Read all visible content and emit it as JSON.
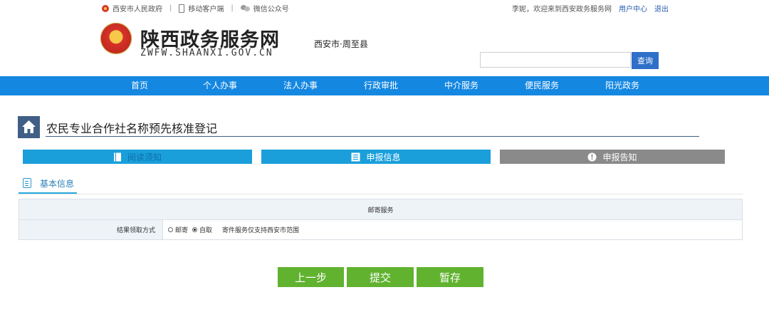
{
  "topbar": {
    "gov_link": "西安市人民政府",
    "mobile_link": "移动客户端",
    "wechat_link": "微信公众号",
    "welcome": "李妮，欢迎来到西安政务服务网",
    "user_center": "用户中心",
    "logout": "退出"
  },
  "header": {
    "site_title": "陕西政务服务网",
    "site_subtitle": "ZWFW.SHAANXI.GOV.CN",
    "region": "西安市·周至县",
    "search_placeholder": "",
    "search_button": "查询"
  },
  "nav": [
    "首页",
    "个人办事",
    "法人办事",
    "行政审批",
    "中介服务",
    "便民服务",
    "阳光政务"
  ],
  "page": {
    "title": "农民专业合作社名称预先核准登记"
  },
  "steps": [
    {
      "label": "阅读须知",
      "state": "done",
      "icon": "document-icon"
    },
    {
      "label": "申报信息",
      "state": "active",
      "icon": "form-icon"
    },
    {
      "label": "申报告知",
      "state": "pending",
      "icon": "alert-icon"
    }
  ],
  "section": {
    "tab_label": "基本信息"
  },
  "form": {
    "group_header": "邮寄服务",
    "field_label": "结果领取方式",
    "options": [
      {
        "label": "邮寄",
        "selected": false
      },
      {
        "label": "自取",
        "selected": true
      }
    ],
    "note": "寄件服务仅支持西安市范围"
  },
  "actions": {
    "prev": "上一步",
    "submit": "提交",
    "save": "暂存"
  },
  "colors": {
    "nav_blue": "#1487e1",
    "step_blue": "#1a9fdb",
    "step_gray": "#8a8a8a",
    "button_green": "#60b22f",
    "home_box": "#3f5f86"
  }
}
